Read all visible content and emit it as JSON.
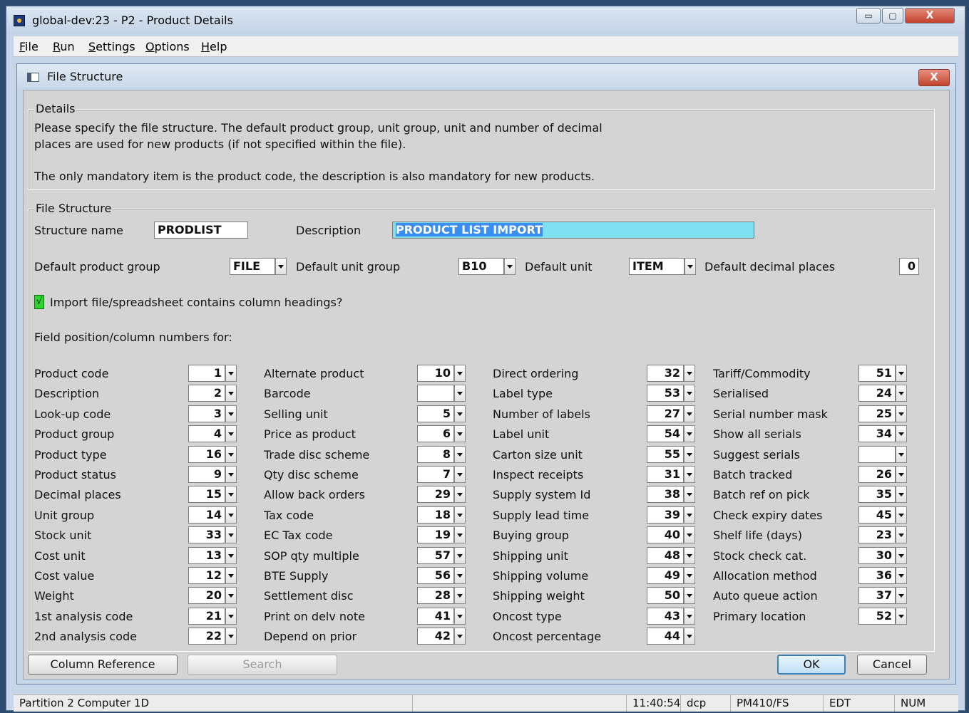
{
  "window": {
    "title": "global-dev:23 - P2 - Product Details",
    "minimize_glyph": "▭",
    "maximize_glyph": "▢",
    "close_glyph": "X"
  },
  "menu": [
    "File",
    "Run",
    "Settings",
    "Options",
    "Help"
  ],
  "dialog": {
    "title": "File Structure",
    "close_glyph": "X",
    "details": {
      "label": "Details",
      "line1": "Please specify the file structure. The default product group, unit group, unit and number of decimal",
      "line2": "places are used for new products (if not specified within the file).",
      "line3": "The only mandatory item is the product code, the description is also mandatory for new products."
    },
    "structure": {
      "label": "File Structure",
      "structure_name_label": "Structure name",
      "structure_name": "PRODLIST",
      "description_label": "Description",
      "description": "PRODUCT LIST IMPORT",
      "default_product_group_label": "Default product group",
      "default_product_group": "FILE",
      "default_unit_group_label": "Default unit group",
      "default_unit_group": "B10",
      "default_unit_label": "Default unit",
      "default_unit": "ITEM",
      "default_decimal_places_label": "Default decimal places",
      "default_decimal_places": "0",
      "headings_checkbox_label": "Import file/spreadsheet contains column headings?",
      "headings_checked_glyph": "√",
      "field_positions_label": "Field position/column numbers for:"
    },
    "columns": [
      [
        {
          "label": "Product code",
          "value": "1"
        },
        {
          "label": "Description",
          "value": "2"
        },
        {
          "label": "Look-up code",
          "value": "3"
        },
        {
          "label": "Product group",
          "value": "4"
        },
        {
          "label": "Product type",
          "value": "16"
        },
        {
          "label": "Product status",
          "value": "9"
        },
        {
          "label": "Decimal places",
          "value": "15"
        },
        {
          "label": "Unit group",
          "value": "14"
        },
        {
          "label": "Stock unit",
          "value": "33"
        },
        {
          "label": "Cost unit",
          "value": "13"
        },
        {
          "label": "Cost value",
          "value": "12"
        },
        {
          "label": "Weight",
          "value": "20"
        },
        {
          "label": "1st analysis code",
          "value": "21"
        },
        {
          "label": "2nd analysis code",
          "value": "22"
        }
      ],
      [
        {
          "label": "Alternate product",
          "value": "10"
        },
        {
          "label": "Barcode",
          "value": ""
        },
        {
          "label": "Selling unit",
          "value": "5"
        },
        {
          "label": "Price as product",
          "value": "6"
        },
        {
          "label": "Trade disc scheme",
          "value": "8"
        },
        {
          "label": "Qty disc scheme",
          "value": "7"
        },
        {
          "label": "Allow back orders",
          "value": "29"
        },
        {
          "label": "Tax code",
          "value": "18"
        },
        {
          "label": "EC Tax code",
          "value": "19"
        },
        {
          "label": "SOP qty multiple",
          "value": "57"
        },
        {
          "label": "BTE Supply",
          "value": "56"
        },
        {
          "label": "Settlement disc",
          "value": "28"
        },
        {
          "label": "Print on delv note",
          "value": "41"
        },
        {
          "label": "Depend on prior",
          "value": "42"
        }
      ],
      [
        {
          "label": "Direct ordering",
          "value": "32"
        },
        {
          "label": "Label type",
          "value": "53"
        },
        {
          "label": "Number of labels",
          "value": "27"
        },
        {
          "label": "Label unit",
          "value": "54"
        },
        {
          "label": "Carton size unit",
          "value": "55"
        },
        {
          "label": "Inspect receipts",
          "value": "31"
        },
        {
          "label": "Supply system Id",
          "value": "38"
        },
        {
          "label": "Supply lead time",
          "value": "39"
        },
        {
          "label": "Buying group",
          "value": "40"
        },
        {
          "label": "Shipping unit",
          "value": "48"
        },
        {
          "label": "Shipping volume",
          "value": "49"
        },
        {
          "label": "Shipping weight",
          "value": "50"
        },
        {
          "label": "Oncost type",
          "value": "43"
        },
        {
          "label": "Oncost percentage",
          "value": "44"
        }
      ],
      [
        {
          "label": "Tariff/Commodity",
          "value": "51"
        },
        {
          "label": "Serialised",
          "value": "24"
        },
        {
          "label": "Serial number mask",
          "value": "25"
        },
        {
          "label": "Show all serials",
          "value": "34"
        },
        {
          "label": "Suggest serials",
          "value": ""
        },
        {
          "label": "Batch tracked",
          "value": "26"
        },
        {
          "label": "Batch ref on pick",
          "value": "35"
        },
        {
          "label": "Check expiry dates",
          "value": "45"
        },
        {
          "label": "Shelf life (days)",
          "value": "23"
        },
        {
          "label": "Stock check cat.",
          "value": "30"
        },
        {
          "label": "Allocation method",
          "value": "36"
        },
        {
          "label": "Auto queue action",
          "value": "37"
        },
        {
          "label": "Primary location",
          "value": "52"
        }
      ]
    ],
    "buttons": {
      "column_reference": "Column Reference",
      "search": "Search",
      "ok": "OK",
      "cancel": "Cancel"
    }
  },
  "status_bar": {
    "partition": "Partition 2 Computer 1D",
    "time": "11:40:54",
    "user": "dcp",
    "program": "PM410/FS",
    "mode": "EDT",
    "num": "NUM"
  }
}
